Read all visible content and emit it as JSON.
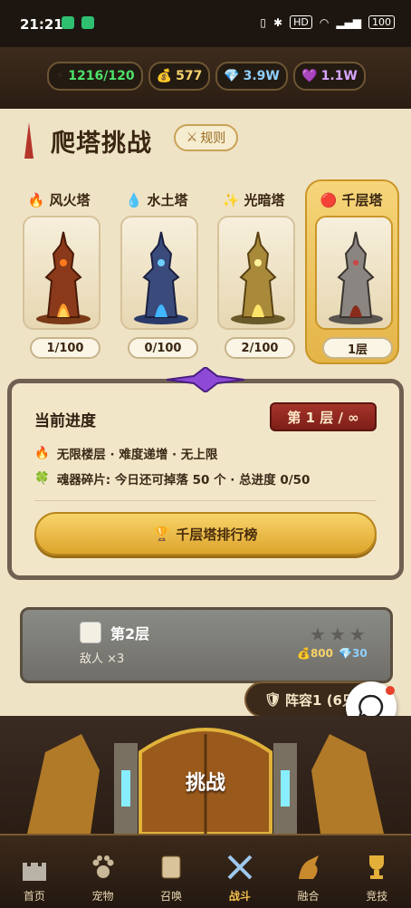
{
  "status": {
    "time": "21:21",
    "hd": "HD",
    "signal": "5G",
    "battery": "100"
  },
  "resources": [
    {
      "icon": "⚡",
      "value": "1216/120",
      "color": "#4ee06a"
    },
    {
      "icon": "💰",
      "value": "577",
      "color": "#f6d36a"
    },
    {
      "icon": "💎",
      "value": "3.9W",
      "color": "#8fd0ff"
    },
    {
      "icon": "💜",
      "value": "1.1W",
      "color": "#d7a6ff"
    }
  ],
  "page": {
    "title": "爬塔挑战",
    "rules_label": "规则"
  },
  "towers": [
    {
      "name": "风火塔",
      "icon": "🔥",
      "progress": "1/100",
      "theme": "fire"
    },
    {
      "name": "水土塔",
      "icon": "💧",
      "progress": "0/100",
      "theme": "water"
    },
    {
      "name": "光暗塔",
      "icon": "✨",
      "progress": "2/100",
      "theme": "light"
    },
    {
      "name": "千层塔",
      "icon": "🔴",
      "progress": "1层",
      "theme": "stone"
    }
  ],
  "progress_panel": {
    "title": "当前进度",
    "floor_badge": "第 1 层 / ∞",
    "line1": "无限楼层 · 难度递增 · 无上限",
    "line2": "魂器碎片: 今日还可掉落 50 个 · 总进度 0/50",
    "rank_button": "千层塔排行榜"
  },
  "stage": {
    "name": "第2层",
    "enemy": "敌人 ×3",
    "gold": "800",
    "gems": "30",
    "stars": 3
  },
  "lineup": {
    "label": "阵容1 (6只"
  },
  "challenge": {
    "label": "挑战"
  },
  "nav": [
    {
      "label": "首页"
    },
    {
      "label": "宠物"
    },
    {
      "label": "召唤"
    },
    {
      "label": "战斗"
    },
    {
      "label": "融合"
    },
    {
      "label": "竞技"
    }
  ]
}
